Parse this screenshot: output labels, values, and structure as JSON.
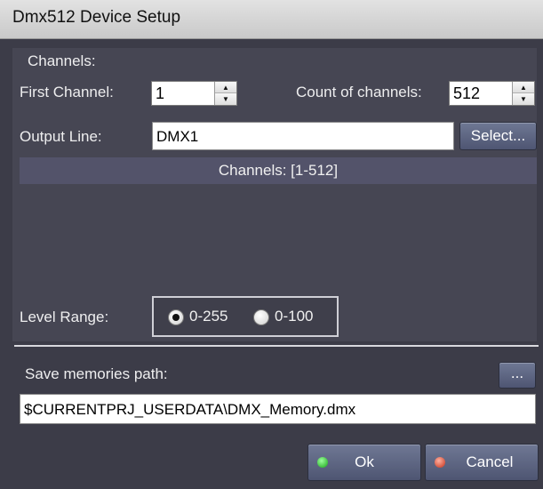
{
  "window": {
    "title": "Dmx512 Device Setup"
  },
  "channels": {
    "section_label": "Channels:",
    "first_channel_label": "First Channel:",
    "first_channel_value": "1",
    "count_label": "Count of channels:",
    "count_value": "512",
    "output_line_label": "Output Line:",
    "output_line_value": "DMX1",
    "select_button": "Select...",
    "range_info": "Channels: [1-512]"
  },
  "level_range": {
    "label": "Level Range:",
    "options": [
      {
        "label": "0-255",
        "selected": true
      },
      {
        "label": "0-100",
        "selected": false
      }
    ]
  },
  "memories": {
    "label": "Save memories path:",
    "browse_button": "...",
    "path_value": "$CURRENTPRJ_USERDATA\\DMX_Memory.dmx"
  },
  "footer": {
    "ok_label": "Ok",
    "cancel_label": "Cancel"
  },
  "colors": {
    "background": "#3f3f4b",
    "button": "#5c6480",
    "ok_led": "#2fcf2f",
    "cancel_led": "#d9452a"
  }
}
